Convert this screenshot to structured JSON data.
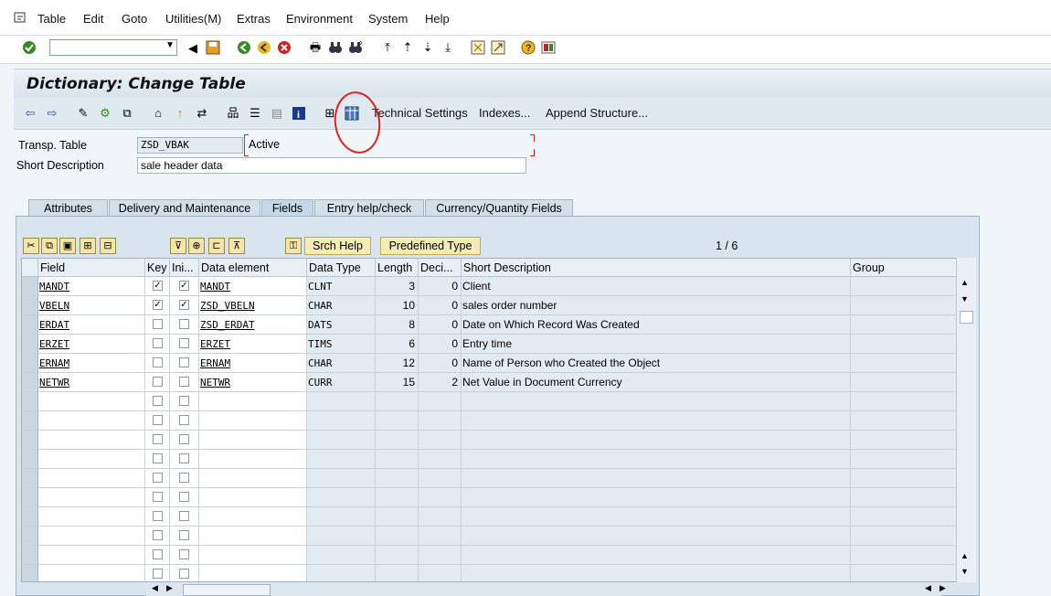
{
  "menu": {
    "items": [
      {
        "label": "Table"
      },
      {
        "label": "Edit"
      },
      {
        "label": "Goto"
      },
      {
        "label": "Utilities(M)"
      },
      {
        "label": "Extras"
      },
      {
        "label": "Environment"
      },
      {
        "label": "System"
      },
      {
        "label": "Help"
      }
    ]
  },
  "title": "Dictionary: Change Table",
  "app_toolbar": {
    "technical_settings": "Technical Settings",
    "indexes": "Indexes...",
    "append_structure": "Append Structure..."
  },
  "header": {
    "transp_table_label": "Transp. Table",
    "transp_table_value": "ZSD_VBAK",
    "status": "Active",
    "short_desc_label": "Short Description",
    "short_desc_value": "sale header data"
  },
  "tabs": [
    {
      "label": "Attributes"
    },
    {
      "label": "Delivery and Maintenance"
    },
    {
      "label": "Fields"
    },
    {
      "label": "Entry help/check"
    },
    {
      "label": "Currency/Quantity Fields"
    }
  ],
  "active_tab": "Fields",
  "grid_toolbar": {
    "srch_help": "Srch Help",
    "predefined_type": "Predefined Type",
    "page_counter": "1 / 6"
  },
  "columns": [
    "Field",
    "Key",
    "Ini...",
    "Data element",
    "Data Type",
    "Length",
    "Deci...",
    "Short Description",
    "Group"
  ],
  "rows": [
    {
      "field": "MANDT",
      "key": true,
      "ini": true,
      "data_element": "MANDT",
      "data_type": "CLNT",
      "length": "3",
      "deci": "0",
      "desc": "Client"
    },
    {
      "field": "VBELN",
      "key": true,
      "ini": true,
      "data_element": "ZSD_VBELN",
      "data_type": "CHAR",
      "length": "10",
      "deci": "0",
      "desc": "sales order number"
    },
    {
      "field": "ERDAT",
      "key": false,
      "ini": false,
      "data_element": "ZSD_ERDAT",
      "data_type": "DATS",
      "length": "8",
      "deci": "0",
      "desc": "Date on Which Record Was Created"
    },
    {
      "field": "ERZET",
      "key": false,
      "ini": false,
      "data_element": "ERZET",
      "data_type": "TIMS",
      "length": "6",
      "deci": "0",
      "desc": "Entry time"
    },
    {
      "field": "ERNAM",
      "key": false,
      "ini": false,
      "data_element": "ERNAM",
      "data_type": "CHAR",
      "length": "12",
      "deci": "0",
      "desc": "Name of Person who Created the Object"
    },
    {
      "field": "NETWR",
      "key": false,
      "ini": false,
      "data_element": "NETWR",
      "data_type": "CURR",
      "length": "15",
      "deci": "2",
      "desc": "Net Value in Document Currency"
    }
  ],
  "empty_rows": 10,
  "colors": {
    "accent": "#dfe9f0",
    "button": "#f6ebb4",
    "annotation": "#e02020"
  }
}
